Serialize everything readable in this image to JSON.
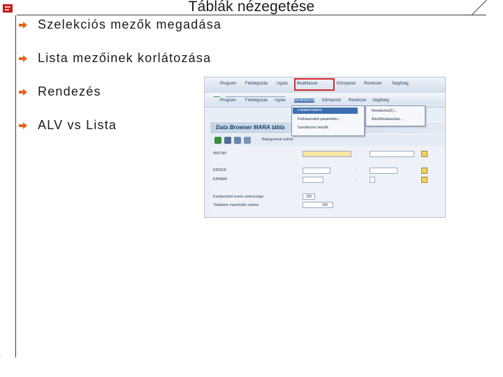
{
  "slide": {
    "title": "Táblák nézegetése",
    "bullets": [
      {
        "text": "Szelekciós mezők megadása",
        "icon": "arrow-bullet-icon"
      },
      {
        "text": "Lista mezőinek korlátozása",
        "icon": "arrow-bullet-icon"
      },
      {
        "text": "Rendezés",
        "icon": "arrow-bullet-icon"
      },
      {
        "text": "ALV vs Lista",
        "icon": "arrow-bullet-icon"
      }
    ],
    "accent_color": "#e8641b"
  },
  "sap_screen": {
    "menu": [
      "Program",
      "Feldolgozás",
      "Ugrás",
      "Beállítások",
      "Környezet",
      "Rendszer",
      "Segítség"
    ],
    "menu_top": [
      "Program",
      "Feldolgozás",
      "Ugrás",
      "Beállítások",
      "Környezet",
      "Rendszer",
      "Segítség"
    ],
    "dropdown_items": [
      "Listaformátum",
      "Felhasználói paraméter...",
      "Szelekciós mezők"
    ],
    "submenu_items": [
      "Rendezés(Σ)...",
      "Mezőkiválasztás..."
    ],
    "window_title": "Data Browser MARA tábla",
    "toolbar_label": "Bejegyzések száma",
    "fields": [
      {
        "label": "MATNR"
      },
      {
        "label": "ERSDA"
      },
      {
        "label": "ERNAM"
      },
      {
        "label": "Kiválasztott sorok szélessége",
        "value": "250"
      },
      {
        "label": "Találatok maximális száma",
        "value": "200"
      }
    ]
  }
}
